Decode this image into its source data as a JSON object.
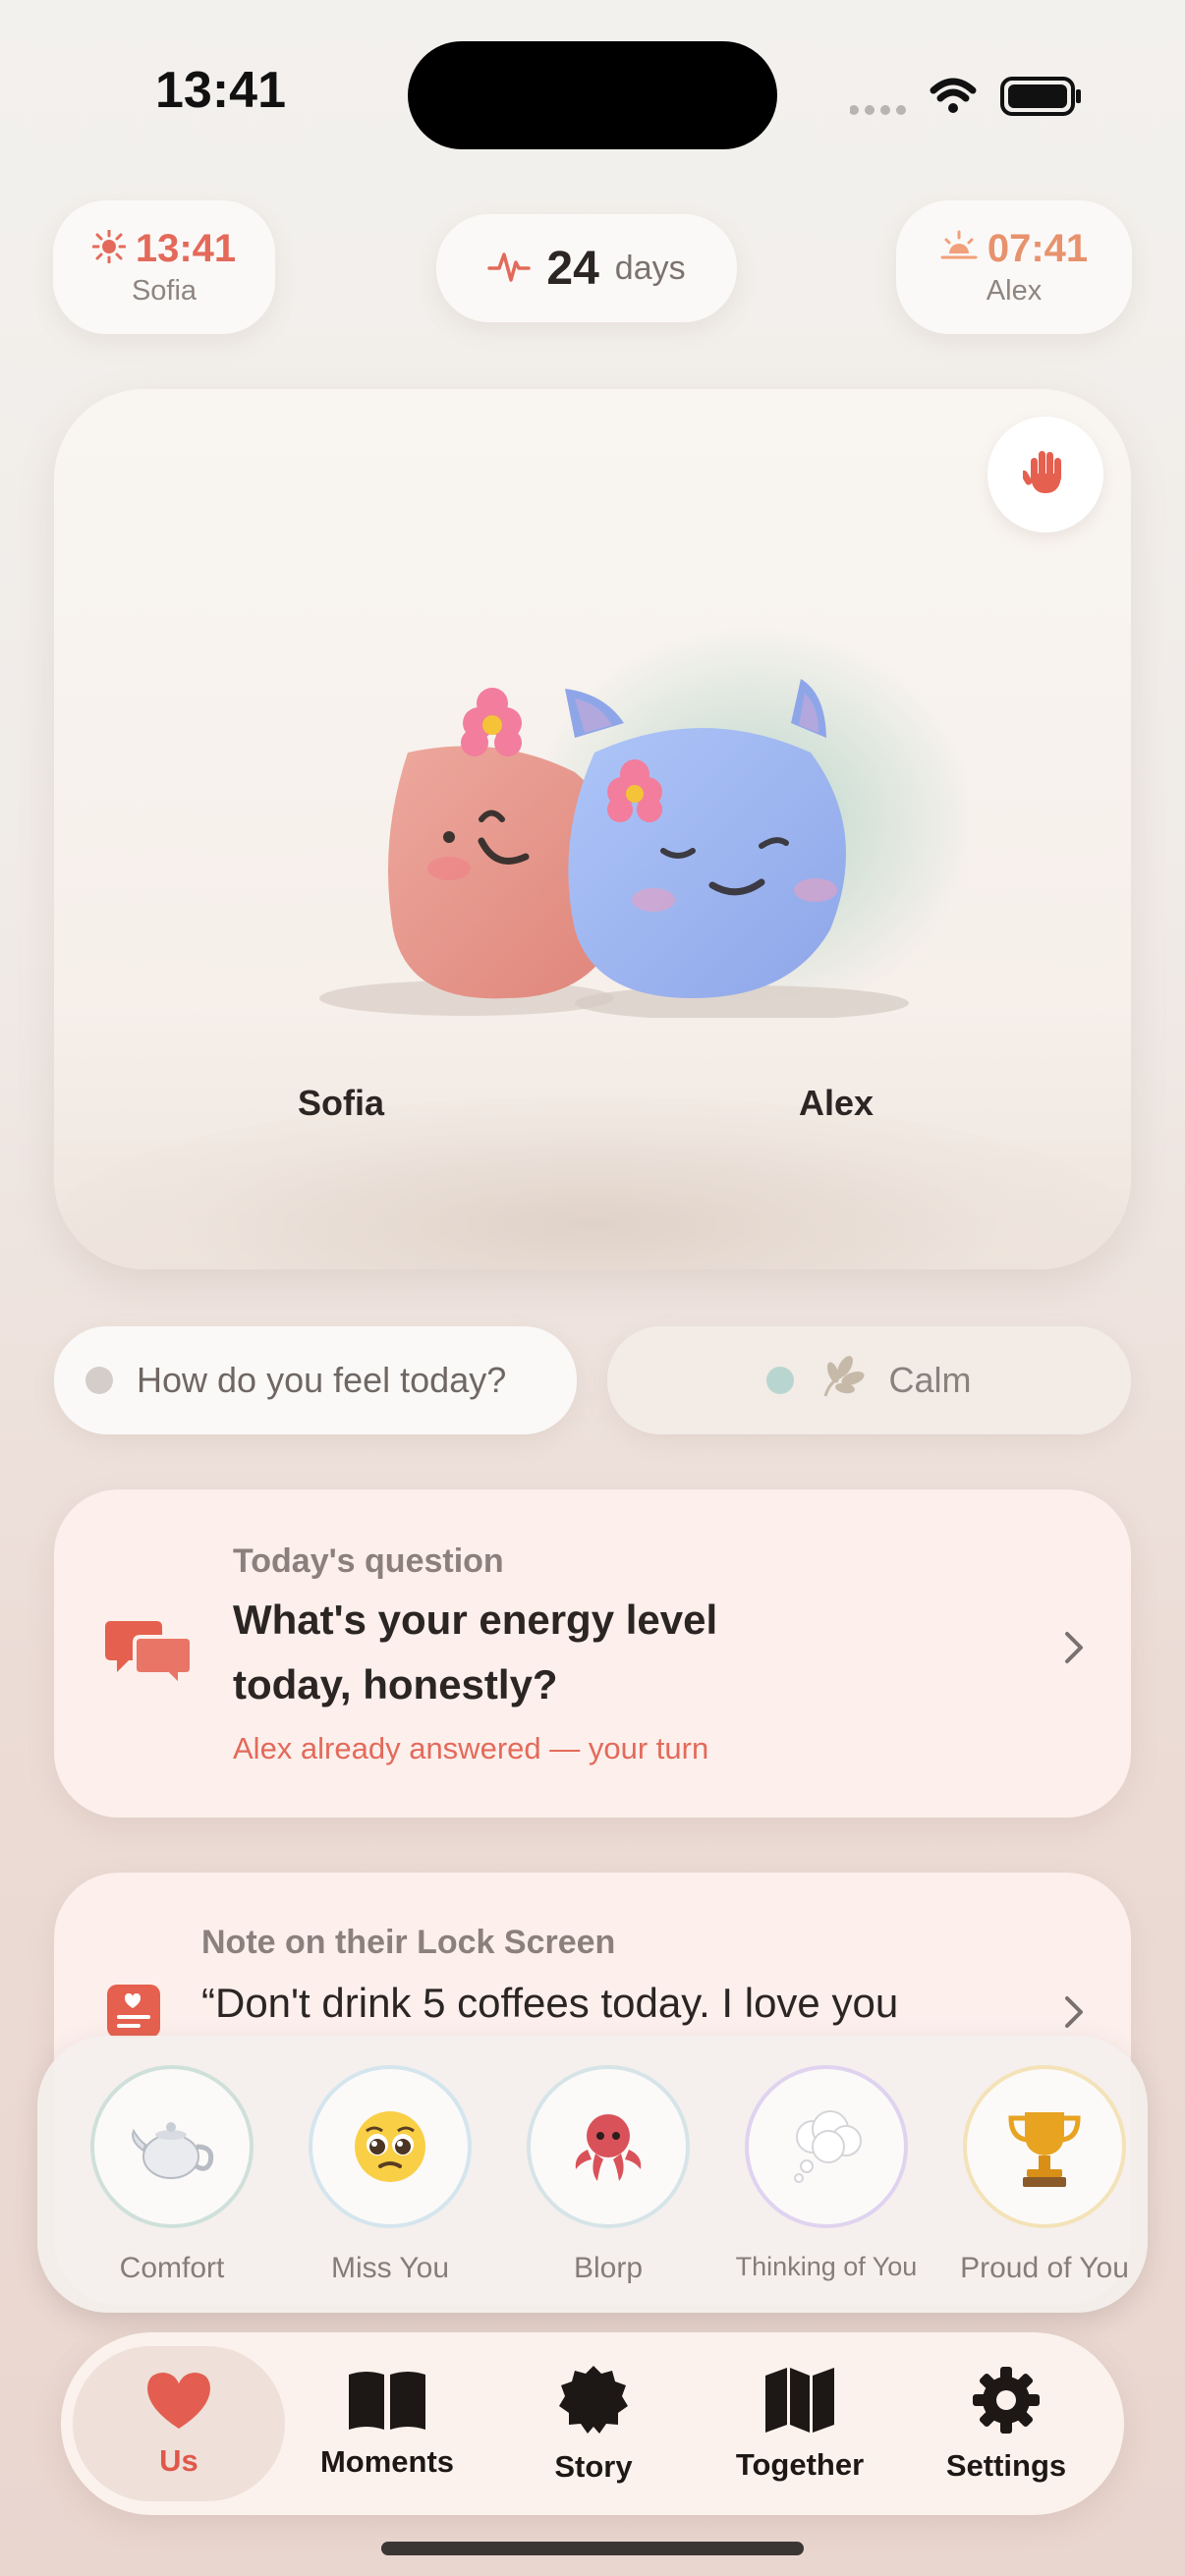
{
  "status_bar": {
    "time": "13:41"
  },
  "header": {
    "left_clock": {
      "time": "13:41",
      "name": "Sofia",
      "icon": "sun-icon"
    },
    "days_counter": {
      "value": "24",
      "label": "days",
      "icon": "heartbeat-icon"
    },
    "right_clock": {
      "time": "07:41",
      "name": "Alex",
      "icon": "sunrise-icon"
    }
  },
  "hero": {
    "left_name": "Sofia",
    "right_name": "Alex",
    "wave_icon": "hand-wave-icon"
  },
  "mood": {
    "prompt": "How do you feel today?",
    "partner_mood": "Calm",
    "partner_mood_icon": "leaf-icon"
  },
  "question_card": {
    "kicker": "Today's question",
    "title_line1": "What's your energy level",
    "title_line2": "today, honestly?",
    "status": "Alex already answered — your turn"
  },
  "note_card": {
    "kicker": "Note on their Lock Screen",
    "text": "“Don't drink 5 coffees today. I love you"
  },
  "reactions": [
    {
      "label": "Comfort",
      "icon": "teapot-icon"
    },
    {
      "label": "Miss You",
      "icon": "pleading-face-icon"
    },
    {
      "label": "Blorp",
      "icon": "octopus-icon"
    },
    {
      "label": "Thinking of You",
      "icon": "thought-bubble-icon"
    },
    {
      "label": "Proud of You",
      "icon": "trophy-icon"
    }
  ],
  "tabs": [
    {
      "label": "Us",
      "icon": "heart-icon",
      "active": true
    },
    {
      "label": "Moments",
      "icon": "book-icon"
    },
    {
      "label": "Story",
      "icon": "badge-icon"
    },
    {
      "label": "Together",
      "icon": "map-icon"
    },
    {
      "label": "Settings",
      "icon": "gear-icon"
    }
  ],
  "colors": {
    "accent": "#e36a5a",
    "sofia_blob": "#e7958a",
    "alex_blob": "#98b0f0",
    "calm_dot": "#b8d6cf"
  }
}
